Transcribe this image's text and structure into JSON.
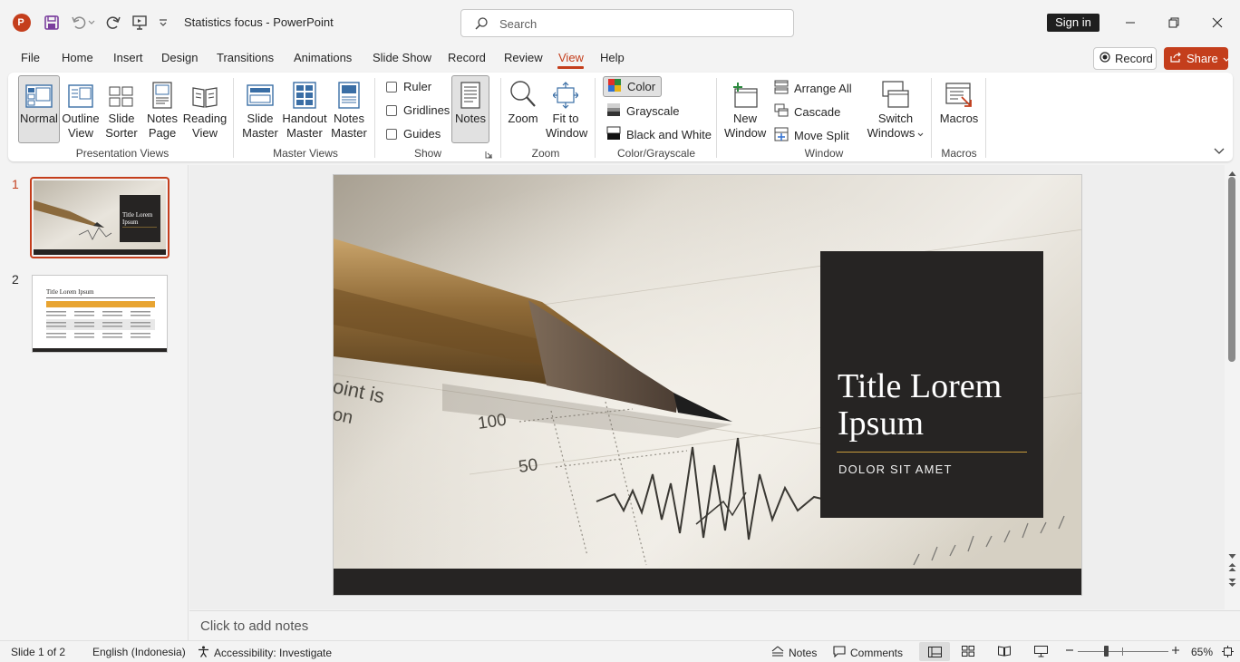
{
  "app": {
    "doc_title": "Statistics focus  -  PowerPoint",
    "search_placeholder": "Search",
    "signin_label": "Sign in"
  },
  "menu": {
    "tabs": [
      "File",
      "Home",
      "Insert",
      "Design",
      "Transitions",
      "Animations",
      "Slide Show",
      "Record",
      "Review",
      "View",
      "Help"
    ],
    "active_tab": "View",
    "record_label": "Record",
    "share_label": "Share"
  },
  "ribbon": {
    "presentation_views": {
      "label": "Presentation Views",
      "normal": "Normal",
      "outline": [
        "Outline",
        "View"
      ],
      "sorter": [
        "Slide",
        "Sorter"
      ],
      "notes_page": [
        "Notes",
        "Page"
      ],
      "reading": [
        "Reading",
        "View"
      ]
    },
    "master_views": {
      "label": "Master Views",
      "slide_master": [
        "Slide",
        "Master"
      ],
      "handout_master": [
        "Handout",
        "Master"
      ],
      "notes_master": [
        "Notes",
        "Master"
      ]
    },
    "show": {
      "label": "Show",
      "ruler": "Ruler",
      "gridlines": "Gridlines",
      "guides": "Guides",
      "notes": "Notes"
    },
    "zoom": {
      "label": "Zoom",
      "zoom": "Zoom",
      "fit": [
        "Fit to",
        "Window"
      ]
    },
    "color": {
      "label": "Color/Grayscale",
      "color": "Color",
      "grayscale": "Grayscale",
      "bw": "Black and White"
    },
    "window": {
      "label": "Window",
      "new_window": [
        "New",
        "Window"
      ],
      "arrange_all": "Arrange All",
      "cascade": "Cascade",
      "move_split": "Move Split",
      "switch": [
        "Switch",
        "Windows"
      ]
    },
    "macros": {
      "label": "Macros",
      "macros": "Macros"
    }
  },
  "slides": [
    {
      "number": "1",
      "thumb_title": "Title Lorem Ipsum"
    },
    {
      "number": "2",
      "thumb_title": "Title Lorem Ipsum"
    }
  ],
  "main_slide": {
    "title": "Title Lorem Ipsum",
    "title_line1": "Title Lorem",
    "title_line2": "Ipsum",
    "subtitle": "DOLOR SIT AMET",
    "chart_numbers": [
      "100",
      "50"
    ],
    "chart_text": [
      "oint is",
      "on"
    ]
  },
  "notes_placeholder": "Click to add notes",
  "status": {
    "slide_count": "Slide 1 of 2",
    "language": "English (Indonesia)",
    "accessibility": "Accessibility: Investigate",
    "notes": "Notes",
    "comments": "Comments",
    "zoom": "65%",
    "zoom_fraction": 0.65
  },
  "colors": {
    "accent": "#c43e1c",
    "slide_dark": "#262423",
    "gold": "#c89b3c"
  }
}
